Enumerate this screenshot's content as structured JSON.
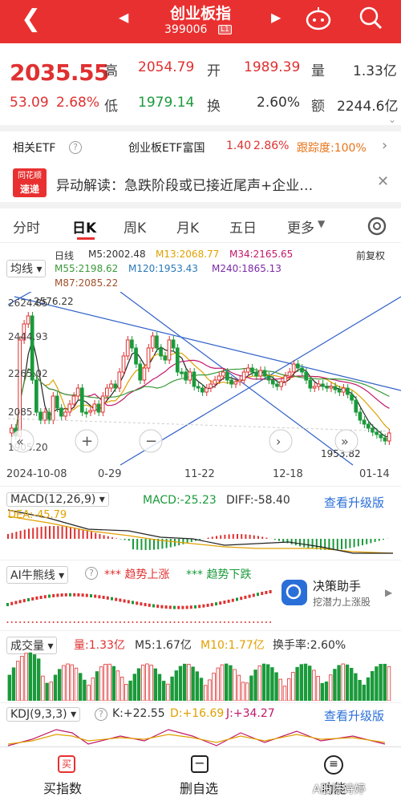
{
  "header": {
    "back_icon": "chevron-left-icon",
    "title": "创业板指",
    "code": "399006",
    "level_badge": "L1",
    "prev": "◀",
    "next": "▶",
    "robot_icon": "robot-icon",
    "search_icon": "search-icon"
  },
  "quote": {
    "price": "2035.55",
    "change": "53.09",
    "change_pct": "2.68%",
    "high_label": "高",
    "high": "2054.79",
    "open_label": "开",
    "open": "1989.39",
    "vol_label": "量",
    "vol": "1.33亿",
    "low_label": "低",
    "low": "1979.14",
    "turn_label": "换",
    "turn": "2.60%",
    "amt_label": "额",
    "amt": "2244.6亿"
  },
  "etf": {
    "label": "相关ETF",
    "name": "创业板ETF富国",
    "price": "1.40",
    "pct": "2.86%",
    "track": "跟踪度:100%"
  },
  "news": {
    "logo_top": "同花顺",
    "logo_bottom": "速递",
    "text": "异动解读：急跌阶段或已接近尾声+企业…"
  },
  "tabs": [
    "分时",
    "日K",
    "周K",
    "月K",
    "五日",
    "更多"
  ],
  "kline": {
    "ma_select": "均线",
    "period": "日线",
    "right_label": "前复权",
    "ma5": "M5:2002.48",
    "ma13": "M13:2068.77",
    "ma34": "M34:2165.65",
    "ma55": "M55:2198.62",
    "ma120": "M120:1953.43",
    "ma240": "M240:1865.13",
    "ma87": "M87:2085.22",
    "y_labels": [
      "2624.85",
      "2444.93",
      "2265.02",
      "2085.",
      "1905.20"
    ],
    "high_mark": "2576.22",
    "low_mark": "1953.82",
    "dates": [
      "2024-10-08",
      "0-29",
      "11-22",
      "12-18",
      "01-14"
    ]
  },
  "macd": {
    "select": "MACD(12,26,9)",
    "macd": "MACD:-25.23",
    "diff": "DIFF:-58.40",
    "dea": "DEA:-45.79",
    "upgrade": "查看升级版"
  },
  "ai": {
    "select": "AI牛熊线",
    "up": "趋势上涨",
    "down": "趋势下跌",
    "helper_title": "决策助手",
    "helper_sub": "挖潜力上涨股"
  },
  "volume": {
    "select": "成交量",
    "vol": "量:1.33亿",
    "m5": "M5:1.67亿",
    "m10": "M10:1.77亿",
    "turn": "换手率:2.60%"
  },
  "kdj": {
    "select": "KDJ(9,3,3)",
    "k": "K:+22.55",
    "d": "D:+16.69",
    "j": "J:+34.27",
    "upgrade": "查看升级版"
  },
  "bottom": {
    "buy": "买指数",
    "buy_icon": "buy-icon",
    "remove": "删自选",
    "remove_icon": "minus-square-icon",
    "func": "功能",
    "func_icon": "menu-icon",
    "watermark": "A股陈诗婷"
  }
}
